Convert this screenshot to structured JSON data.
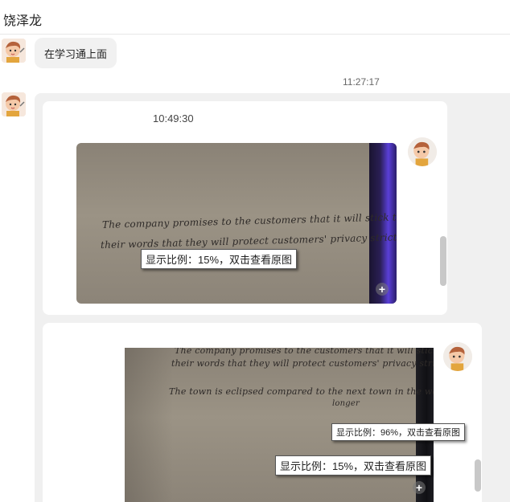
{
  "header": {
    "title": "饶泽龙"
  },
  "messages": [
    {
      "type": "text",
      "text": "在学习通上面"
    }
  ],
  "timestamp": "11:27:17",
  "forwarded": {
    "cards": [
      {
        "time": "10:49:30",
        "handwriting": [
          "The company promises to the customers that it will stick to",
          "their words that they will protect customers' privacy strictly"
        ],
        "zoom_label": "显示比例：15%，双击查看原图"
      },
      {
        "handwriting": [
          "The company promises to the customers that it will stick to",
          "their words that they will protect customers' privacy strictly",
          "The town is eclipsed compared to the next town in the world.",
          "longer"
        ],
        "zoom_label_small": "显示比例：96%，双击查看原图",
        "zoom_label": "显示比例：15%，双击查看原图"
      }
    ]
  },
  "icons": {
    "avatar": "cartoon-avatar-icon",
    "zoom": "plus-magnifier-icon"
  },
  "colors": {
    "bubble": "#f1f1f1",
    "forward_bg": "#f0f0f0",
    "card": "#ffffff",
    "screen_glow": "#5a3fd8"
  }
}
